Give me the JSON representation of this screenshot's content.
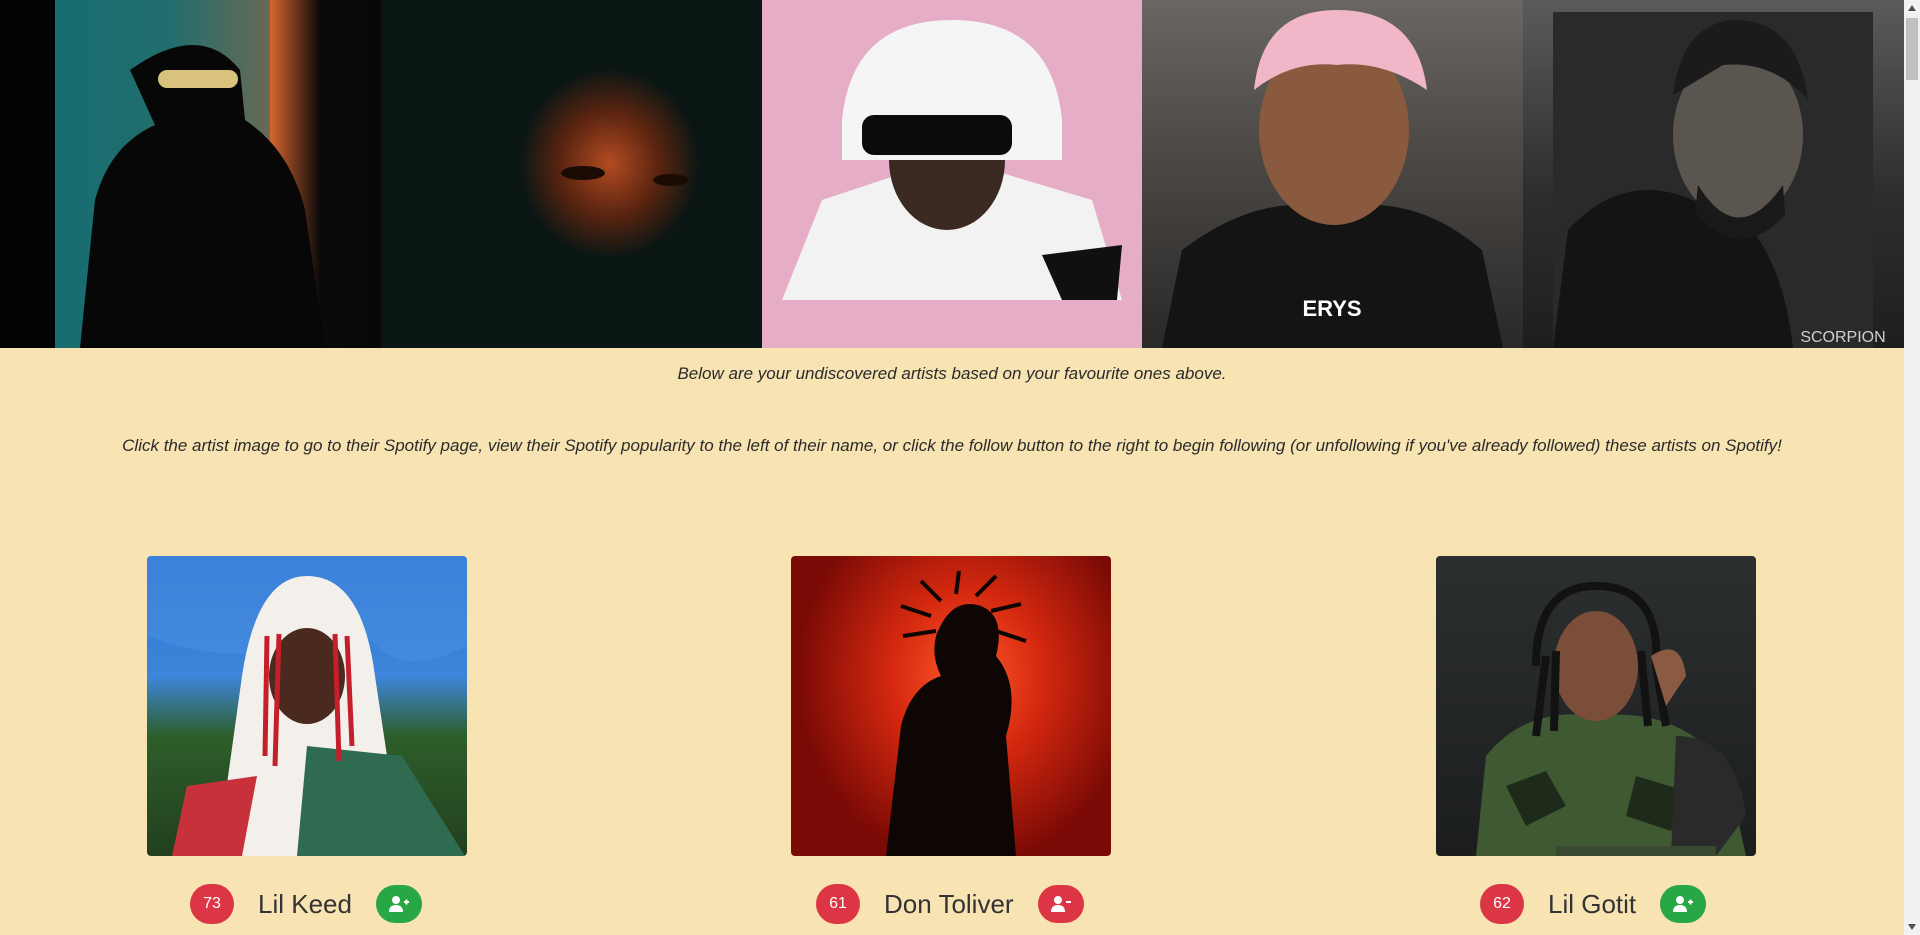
{
  "banner": {
    "artists": [
      {
        "icon": "artist-photo-1"
      },
      {
        "icon": "artist-photo-2"
      },
      {
        "icon": "artist-photo-3"
      },
      {
        "icon": "artist-photo-4"
      },
      {
        "icon": "artist-photo-5"
      }
    ]
  },
  "intro": {
    "line1": "Below are your undiscovered artists based on your favourite ones above.",
    "line2": "Click the artist image to go to their Spotify page, view their Spotify popularity to the left of their name, or click the follow button to the right to begin following (or unfollowing if you've already followed) these artists on Spotify!"
  },
  "artists": [
    {
      "name": "Lil Keed",
      "popularity": "73",
      "follow_state": "follow"
    },
    {
      "name": "Don Toliver",
      "popularity": "61",
      "follow_state": "unfollow"
    },
    {
      "name": "Lil Gotit",
      "popularity": "62",
      "follow_state": "follow"
    }
  ],
  "colors": {
    "page_background": "#f8e3b3",
    "badge": "#dc3545",
    "follow": "#28a745",
    "unfollow": "#dc3545"
  }
}
